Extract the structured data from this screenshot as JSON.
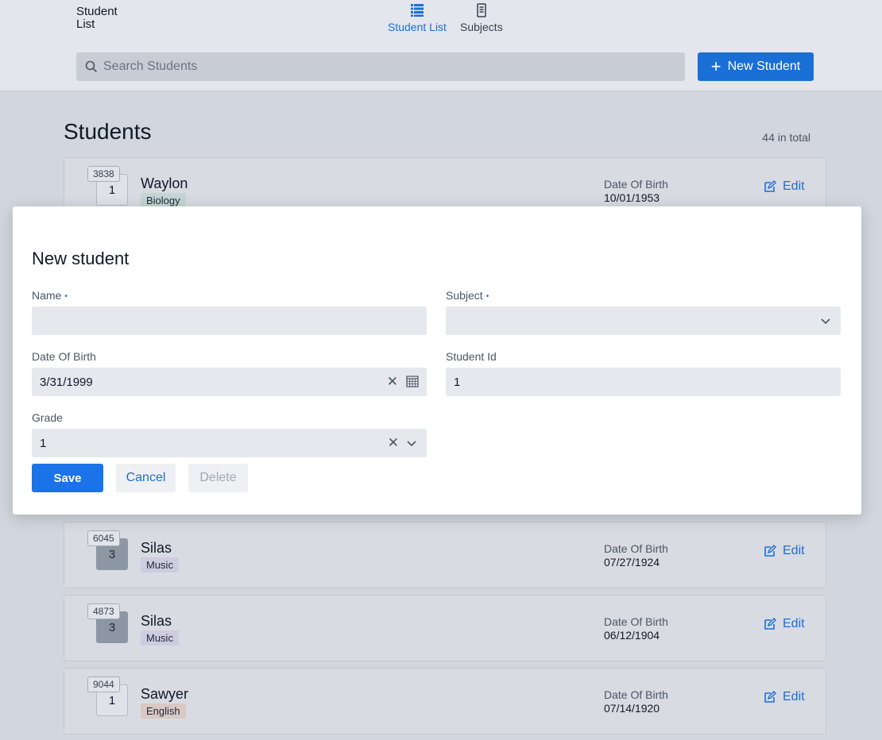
{
  "app": {
    "title_line1": "Student",
    "title_line2": "List"
  },
  "nav": {
    "items": [
      {
        "label": "Student List",
        "icon": "list-icon",
        "active": true
      },
      {
        "label": "Subjects",
        "icon": "book-icon",
        "active": false
      }
    ]
  },
  "search": {
    "placeholder": "Search Students"
  },
  "new_student_button": {
    "label": "New Student"
  },
  "list": {
    "heading": "Students",
    "total": "44 in total",
    "students": [
      {
        "id": "3838",
        "grade": "1",
        "name": "Waylon",
        "subject": "Biology",
        "dob_label": "Date Of Birth",
        "dob": "10/01/1953",
        "edit": "Edit"
      },
      {
        "id": "6045",
        "grade": "3",
        "name": "Silas",
        "subject": "Music",
        "dob_label": "Date Of Birth",
        "dob": "07/27/1924",
        "edit": "Edit"
      },
      {
        "id": "4873",
        "grade": "3",
        "name": "Silas",
        "subject": "Music",
        "dob_label": "Date Of Birth",
        "dob": "06/12/1904",
        "edit": "Edit"
      },
      {
        "id": "9044",
        "grade": "1",
        "name": "Sawyer",
        "subject": "English",
        "dob_label": "Date Of Birth",
        "dob": "07/14/1920",
        "edit": "Edit"
      }
    ]
  },
  "dialog": {
    "title": "New student",
    "required_marker": "•",
    "fields": {
      "name": {
        "label": "Name",
        "value": ""
      },
      "subject": {
        "label": "Subject",
        "value": ""
      },
      "dob": {
        "label": "Date Of Birth",
        "value": "3/31/1999"
      },
      "student_id": {
        "label": "Student Id",
        "value": "1"
      },
      "grade": {
        "label": "Grade",
        "value": "1"
      }
    },
    "buttons": {
      "save": "Save",
      "cancel": "Cancel",
      "delete": "Delete"
    }
  },
  "colors": {
    "accent": "#1a6fd6",
    "save": "#1a73e8",
    "badge_biology": "#c3d6d4",
    "badge_music": "#cfcbe0",
    "badge_english": "#d9c8c4"
  }
}
